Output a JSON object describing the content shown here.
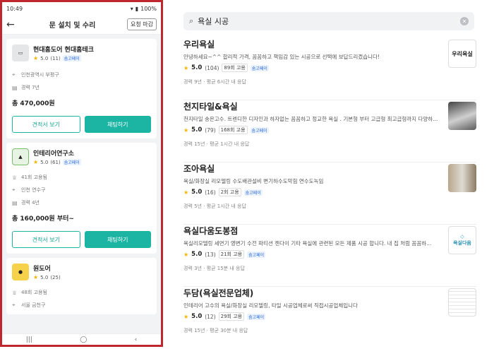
{
  "phone": {
    "status": {
      "time": "10:49",
      "battery": "100%"
    },
    "header": {
      "title": "문 설치 및 수리",
      "close_label": "요청 마감"
    },
    "cards": [
      {
        "name": "현대홈도어 현대홈테크",
        "rating": "5.0",
        "count": "(11)",
        "pay": "숨고페이",
        "location": "인천광역시 부평구",
        "experience": "경력 7년",
        "price": "총 470,000원",
        "quote_label": "견적서 보기",
        "chat_label": "채팅하기"
      },
      {
        "name": "인테리어연구소",
        "rating": "5.0",
        "count": "(61)",
        "pay": "숨고페이",
        "hires": "41회 고용됨",
        "location": "인천 연수구",
        "experience": "경력 4년",
        "price": "총 160,000원 부터~",
        "quote_label": "견적서 보기",
        "chat_label": "채팅하기"
      },
      {
        "name": "원도어",
        "rating": "5.0",
        "count": "(25)",
        "hires": "48회 고용됨",
        "location": "서울 금천구"
      }
    ]
  },
  "search": {
    "value": "욕실 시공"
  },
  "results": [
    {
      "name": "우리욕실",
      "desc": "안녕하세요~^^ 합리적 가격, 꼼꼼하고 책임감 있는 시공으로 선택에 보답드리겠습니다!",
      "rating": "5.0",
      "count": "(104)",
      "hires": "89회 고용",
      "pay": "숨고페이",
      "meta": "경력 9년 · 평균 6시간 내 응답",
      "thumb_text": "우리욕실"
    },
    {
      "name": "천지타일&욕실",
      "desc": "천지타일 송은고수. 트렌디한 디자인과 하자없는 꼼꼼하고 정교한 욕실 . 기본형 부터 고급형 최고급형까지 다양하...",
      "rating": "5.0",
      "count": "(79)",
      "hires": "168회 고용",
      "pay": "숨고페이",
      "meta": "경력 15년 · 평균 1시간 내 응답",
      "thumb_text": ""
    },
    {
      "name": "조아욕실",
      "desc": "욕실/화장실 리모델링 수도배관설비 변기하수도막힘 연수도녹임",
      "rating": "5.0",
      "count": "(16)",
      "hires": "2회 고용",
      "pay": "숨고페이",
      "meta": "경력 5년 · 평균 1시간 내 응답",
      "thumb_text": ""
    },
    {
      "name": "욕실다움도봉점",
      "desc": "욕실리모델링 세면기 영변기 수전 파티션 젠다이 기타 욕실에 관련된 모든 제품 시공 합니다. 내 집 처럼 꼼꼼하...",
      "rating": "5.0",
      "count": "(13)",
      "hires": "21회 고용",
      "pay": "숨고페이",
      "meta": "경력 3년 · 평균 15분 내 응답",
      "thumb_text": "욕실다움"
    },
    {
      "name": "두담(욕실전문업체)",
      "desc": "인테리어 고수의 욕실/화장실 리모델링, 타일 시공업체로써 직접시공업체입니다",
      "rating": "5.0",
      "count": "(12)",
      "hires": "29회 고용",
      "pay": "숨고페이",
      "meta": "경력 15년 · 평균 30분 내 응답",
      "thumb_text": ""
    }
  ]
}
